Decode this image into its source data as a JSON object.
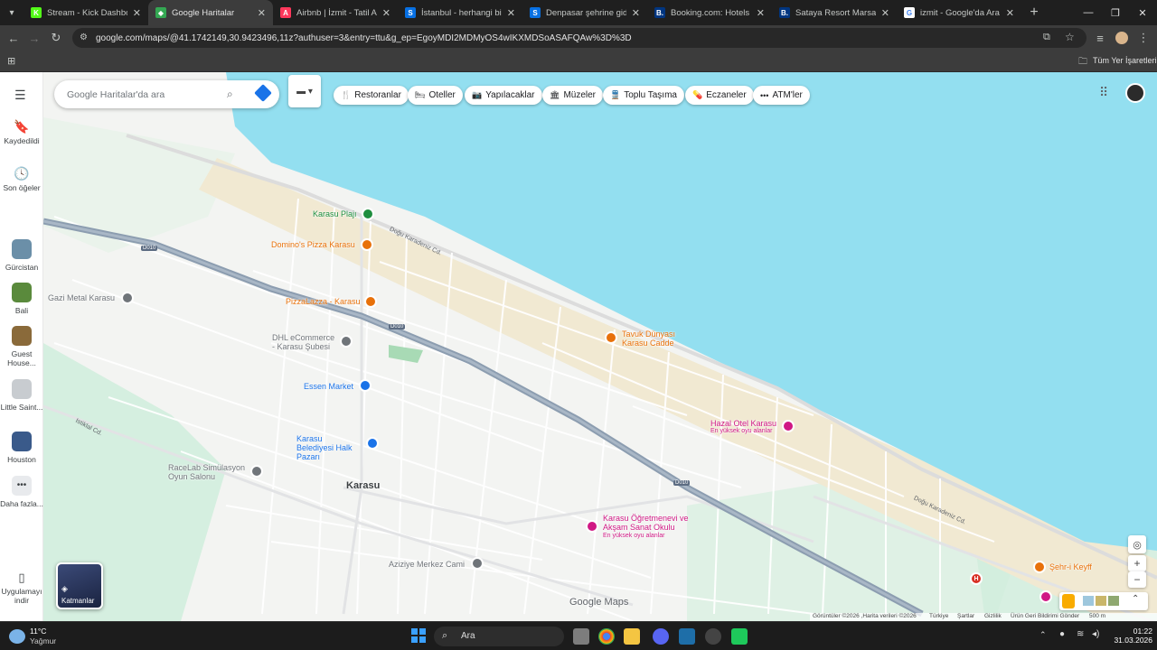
{
  "browser": {
    "tabs": [
      {
        "title": "Stream - Kick Dashboard",
        "icon": "kick-icon",
        "color": "#53fc18",
        "glyph": "K"
      },
      {
        "title": "Google Haritalar",
        "icon": "google-maps-icon",
        "color": "#34a853",
        "glyph": "◆",
        "active": true
      },
      {
        "title": "Airbnb | İzmit - Tatil Ama...",
        "icon": "airbnb-icon",
        "color": "#ff385c",
        "glyph": "A"
      },
      {
        "title": "İstanbul - herhangi bir ye...",
        "icon": "skyscanner-icon",
        "color": "#0770e3",
        "glyph": "S"
      },
      {
        "title": "Denpasar şehrine gidiş dö...",
        "icon": "skyscanner-icon",
        "color": "#0770e3",
        "glyph": "S"
      },
      {
        "title": "Booking.com: Hotels in M...",
        "icon": "booking-icon",
        "color": "#003580",
        "glyph": "B."
      },
      {
        "title": "Sataya Resort Marsa Alam...",
        "icon": "booking-icon",
        "color": "#003580",
        "glyph": "B."
      },
      {
        "title": "izmit - Google'da Ara",
        "icon": "google-icon",
        "color": "#ffffff",
        "glyph": "G"
      }
    ],
    "url": "google.com/maps/@41.1742149,30.9423496,11z?authuser=3&entry=ttu&g_ep=EgoyMDI2MDMyOS4wIKXMDSoASAFQAw%3D%3D",
    "bookmarks_label": "Tüm Yer İşaretleri"
  },
  "maps": {
    "search_placeholder": "Google Haritalar'da ara",
    "rail": {
      "saved": "Kaydedildi",
      "recent": "Son öğeler",
      "places": [
        {
          "label": "Gürcistan",
          "color": "#6b8fa8"
        },
        {
          "label": "Bali",
          "color": "#5a8a3c"
        },
        {
          "label": "Guest House...",
          "color": "#8a6a3a"
        },
        {
          "label": "Little Saint...",
          "color": "#c8ccd0"
        },
        {
          "label": "Houston",
          "color": "#3a5a8a"
        }
      ],
      "more": "Daha fazla...",
      "app": "Uygulamayı indir"
    },
    "categories": [
      {
        "label": "Restoranlar",
        "icon": "restaurant-icon",
        "glyph": "🍴"
      },
      {
        "label": "Oteller",
        "icon": "hotel-icon",
        "glyph": "🛏"
      },
      {
        "label": "Yapılacaklar",
        "icon": "camera-icon",
        "glyph": "📷"
      },
      {
        "label": "Müzeler",
        "icon": "museum-icon",
        "glyph": "🏛"
      },
      {
        "label": "Toplu Taşıma",
        "icon": "transit-icon",
        "glyph": "🚆"
      },
      {
        "label": "Eczaneler",
        "icon": "pharmacy-icon",
        "glyph": "💊"
      },
      {
        "label": "ATM'ler",
        "icon": "atm-icon",
        "glyph": "•••"
      }
    ],
    "places": [
      {
        "name": "Karasu Plajı",
        "color": "#1e8e3e"
      },
      {
        "name": "Domino's Pizza Karasu",
        "color": "#e8710a"
      },
      {
        "name": "PizzaLazza - Karasu",
        "color": "#e8710a"
      },
      {
        "name": "Gazi Metal Karasu",
        "color": "#70757a"
      },
      {
        "name": "DHL eCommerce - Karasu Şubesi",
        "color": "#70757a"
      },
      {
        "name": "Essen Market",
        "color": "#1a73e8"
      },
      {
        "name": "Karasu Belediyesi Halk Pazarı",
        "color": "#1a73e8"
      },
      {
        "name": "RaceLab Simülasyon Oyun Salonu",
        "color": "#70757a"
      },
      {
        "name": "Karasu",
        "color": "#3c4043"
      },
      {
        "name": "Tavuk Dünyası Karasu Cadde",
        "color": "#e8710a"
      },
      {
        "name": "Hazal Otel Karasu",
        "color": "#d01884"
      },
      {
        "name": "Karasu Öğretmenevi ve Akşam Sanat Okulu",
        "color": "#d01884"
      },
      {
        "name": "Aziziye Merkez Cami",
        "color": "#70757a"
      },
      {
        "name": "Şehr-i Keyff",
        "color": "#e8710a"
      }
    ],
    "sublabel": "En yüksek oyu alanlar",
    "roads": [
      "Doğu Karadeniz Cd.",
      "Istiklal Cd.",
      "D010"
    ],
    "layers_label": "Katmanlar",
    "brand": "Google Maps",
    "footer": [
      "Görüntüler ©2026 ,Harita verileri ©2026",
      "Türkiye",
      "Şartlar",
      "Gizlilik",
      "Ürün Geri Bildirimi Gönder",
      "500 m"
    ]
  },
  "taskbar": {
    "weather_temp": "11°C",
    "weather_desc": "Yağmur",
    "search": "Ara",
    "time": "01:22",
    "date": "31.03.2026"
  }
}
